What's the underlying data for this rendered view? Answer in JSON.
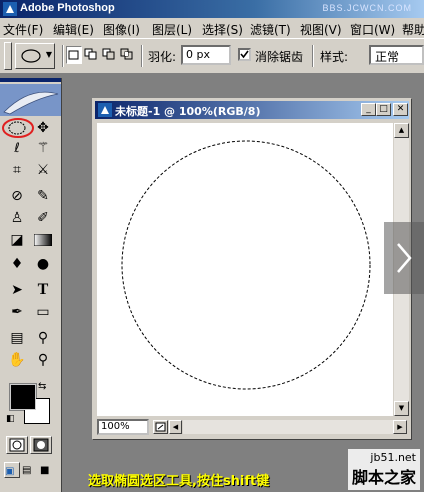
{
  "window": {
    "title": "Adobe Photoshop",
    "watermark": "BBS.JCWCN.COM"
  },
  "menu": {
    "items": [
      "文件(F)",
      "编辑(E)",
      "图像(I)",
      "图层(L)",
      "选择(S)",
      "滤镜(T)",
      "视图(V)",
      "窗口(W)",
      "帮助"
    ]
  },
  "options_bar": {
    "feather_label": "羽化:",
    "feather_value": "0 px",
    "antialias_label": "消除锯齿",
    "antialias_checked": true,
    "style_label": "样式:",
    "style_value": "正常"
  },
  "document": {
    "title": "未标题-1 @ 100%(RGB/8)",
    "zoom": "100%"
  },
  "overlay": {
    "caption": "选取椭圆选区工具,按住shift键",
    "site_url": "jb51.net",
    "site_name": "脚本之家"
  },
  "colors": {
    "titlebar": "#0a246a",
    "chrome": "#d4d0c8",
    "workspace": "#808080",
    "highlight_circle": "#e02020",
    "caption": "#ffff00"
  }
}
